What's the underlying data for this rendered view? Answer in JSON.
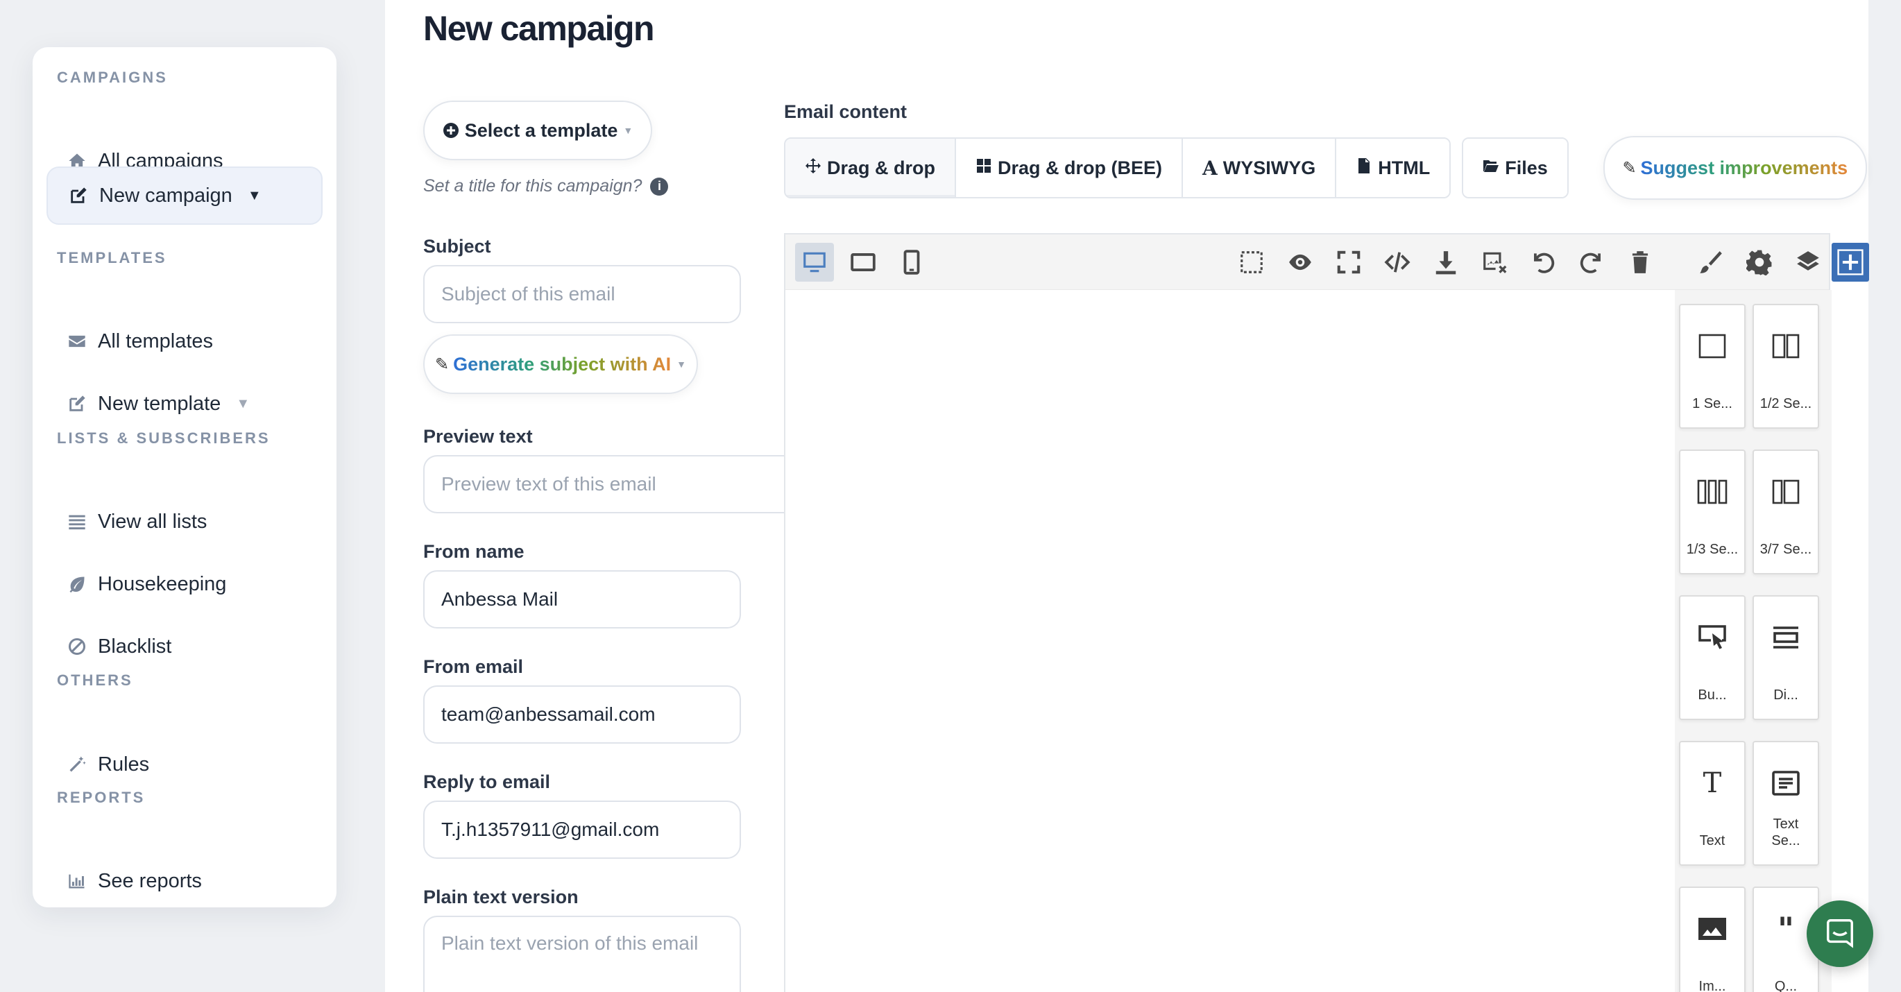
{
  "sidebar": {
    "sections": [
      {
        "title": "CAMPAIGNS"
      },
      {
        "title": "TEMPLATES"
      },
      {
        "title": "LISTS & SUBSCRIBERS"
      },
      {
        "title": "OTHERS"
      },
      {
        "title": "REPORTS"
      }
    ],
    "items": [
      {
        "label": "All campaigns",
        "icon": "home-icon"
      },
      {
        "label": "New campaign",
        "icon": "edit-icon",
        "active": true
      },
      {
        "label": "All templates",
        "icon": "envelope-icon"
      },
      {
        "label": "New template",
        "icon": "edit-icon"
      },
      {
        "label": "View all lists",
        "icon": "list-icon"
      },
      {
        "label": "Housekeeping",
        "icon": "leaf-icon"
      },
      {
        "label": "Blacklist",
        "icon": "ban-icon"
      },
      {
        "label": "Rules",
        "icon": "wand-icon"
      },
      {
        "label": "See reports",
        "icon": "bar-chart-icon"
      }
    ]
  },
  "main": {
    "title": "New campaign",
    "select_template": "Select a template",
    "title_hint": "Set a title for this campaign?",
    "subject": {
      "label": "Subject",
      "placeholder": "Subject of this email"
    },
    "generate_subject": "Generate subject with AI",
    "preview_text": {
      "label": "Preview text",
      "placeholder": "Preview text of this email"
    },
    "from_name": {
      "label": "From name",
      "value": "Anbessa Mail"
    },
    "from_email": {
      "label": "From email",
      "value": "team@anbessamail.com"
    },
    "reply_to": {
      "label": "Reply to email",
      "value": "T.j.h1357911@gmail.com"
    },
    "plain_text": {
      "label": "Plain text version",
      "placeholder": "Plain text version of this email"
    }
  },
  "email_content": {
    "label": "Email content",
    "tabs": [
      "Drag & drop",
      "Drag & drop (BEE)",
      "WYSIWYG",
      "HTML"
    ],
    "files": "Files",
    "suggest": "Suggest improvements"
  },
  "blocks": [
    {
      "label": "1 Se...",
      "icon": "one-section-icon"
    },
    {
      "label": "1/2 Se...",
      "icon": "two-section-icon"
    },
    {
      "label": "1/3 Se...",
      "icon": "three-section-icon"
    },
    {
      "label": "3/7 Se...",
      "icon": "three-seven-section-icon"
    },
    {
      "label": "Bu...",
      "icon": "button-block-icon"
    },
    {
      "label": "Di...",
      "icon": "divider-icon"
    },
    {
      "label": "Text",
      "icon": "text-icon"
    },
    {
      "label": "Text Se...",
      "icon": "text-section-icon"
    },
    {
      "label": "Im...",
      "icon": "image-icon"
    },
    {
      "label": "Q...",
      "icon": "quote-icon"
    }
  ],
  "colors": {
    "accent": "#3b6fb6",
    "chat": "#2e7d4f"
  }
}
